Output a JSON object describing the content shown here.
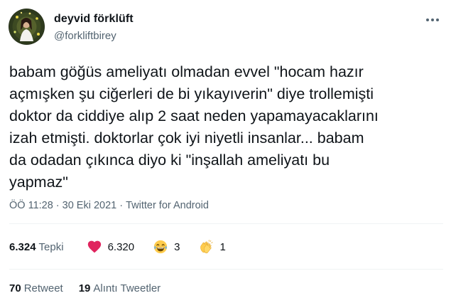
{
  "author": {
    "name": "deyvid förklüft",
    "handle": "@forkliftbirey"
  },
  "tweet": {
    "text": "babam göğüs ameliyatı olmadan evvel \"hocam hazır\naçmışken şu ciğerleri de bi yıkayıverin\" diye trollemişti\ndoktor da ciddiye alıp 2 saat neden yapamayacaklarını\nizah etmişti. doktorlar çok iyi niyetli insanlar... babam\nda odadan çıkınca diyo ki \"inşallah ameliyatı bu\nyapmaz\"",
    "time": "ÖÖ 11:28",
    "separator": "·",
    "date": "30 Eki 2021",
    "source": "Twitter for Android"
  },
  "reactions": {
    "total_count": "6.324",
    "total_label": "Tepki",
    "items": [
      {
        "icon": "heart-icon",
        "count": "6.320",
        "color": "#e0245e"
      },
      {
        "icon": "laughing-face-icon",
        "count": "3"
      },
      {
        "icon": "clapping-hands-icon",
        "count": "1"
      }
    ]
  },
  "stats": {
    "retweets_count": "70",
    "retweets_label": "Retweet",
    "quotes_count": "19",
    "quotes_label": "Alıntı Tweetler"
  },
  "colors": {
    "text": "#0f1419",
    "secondary": "#536471",
    "divider": "#eff3f4",
    "heart": "#e0245e"
  }
}
